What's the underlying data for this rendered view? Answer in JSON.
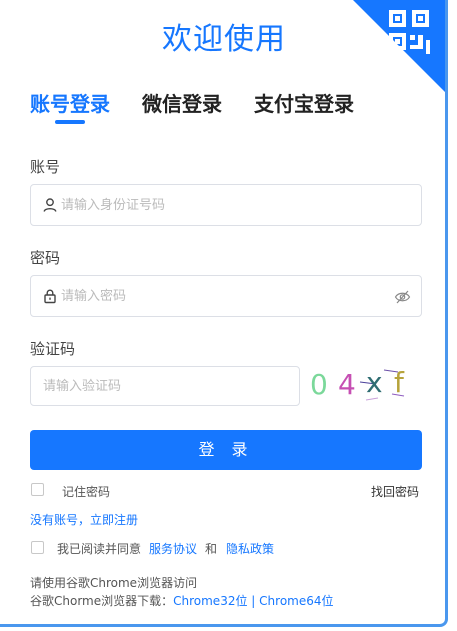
{
  "header": {
    "title": "欢迎使用"
  },
  "tabs": [
    {
      "label": "账号登录",
      "active": true
    },
    {
      "label": "微信登录",
      "active": false
    },
    {
      "label": "支付宝登录",
      "active": false
    }
  ],
  "account": {
    "label": "账号",
    "placeholder": "请输入身份证号码"
  },
  "password": {
    "label": "密码",
    "placeholder": "请输入密码"
  },
  "captcha": {
    "label": "验证码",
    "placeholder": "请输入验证码",
    "chars": [
      {
        "ch": "0",
        "color": "#7bd89a"
      },
      {
        "ch": "4",
        "color": "#c64fb3"
      },
      {
        "ch": "x",
        "color": "#2f6d72"
      },
      {
        "ch": "f",
        "color": "#b6a33b"
      }
    ]
  },
  "login_button": "登 录",
  "remember": {
    "label": "记住密码"
  },
  "forgot": "找回密码",
  "register": "没有账号，立即注册",
  "agreement": {
    "prefix": "我已阅读并同意",
    "service": "服务协议",
    "and": "和",
    "privacy": "隐私政策"
  },
  "footer": {
    "line1": "请使用谷歌Chrome浏览器访问",
    "line2_prefix": "谷歌Chorme浏览器下载：",
    "chrome32": "Chrome32位",
    "separator": "|",
    "chrome64": "Chrome64位"
  },
  "colors": {
    "primary": "#1677ff",
    "border": "#4a97ee"
  }
}
